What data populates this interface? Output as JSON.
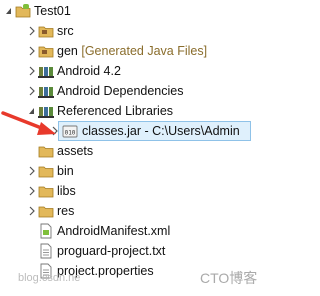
{
  "tree": {
    "project": "Test01",
    "src": "src",
    "gen": "gen",
    "gen_decoration": "[Generated Java Files]",
    "android": "Android 4.2",
    "deps": "Android Dependencies",
    "reflibs": "Referenced Libraries",
    "classes": "classes.jar - C:\\Users\\Admin",
    "assets": "assets",
    "bin": "bin",
    "libs": "libs",
    "res": "res",
    "manifest": "AndroidManifest.xml",
    "proguard": "proguard-project.txt",
    "properties": "project.properties"
  },
  "watermark": {
    "left": "blog.csdn.ne",
    "right": "CTO博客"
  },
  "colors": {
    "selection_bg": "#dff0fc",
    "selection_border": "#8fc2e8",
    "annotation_arrow": "#e8392b"
  }
}
